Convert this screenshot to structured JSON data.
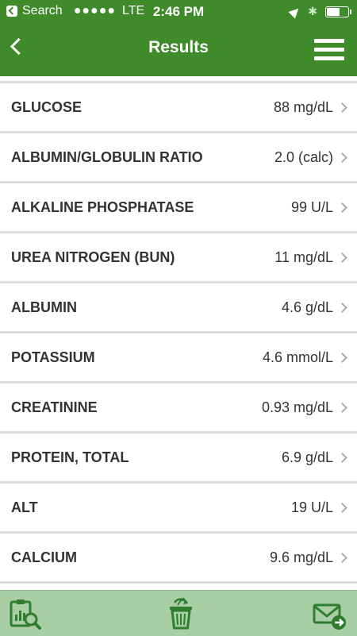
{
  "status_bar": {
    "carrier": "Search",
    "signal": "●●●●●",
    "network": "LTE",
    "time": "2:46 PM",
    "battery_level": 0.6
  },
  "nav": {
    "title": "Results"
  },
  "results": [
    {
      "name": "GLUCOSE",
      "value": "88 mg/dL"
    },
    {
      "name": "ALBUMIN/GLOBULIN RATIO",
      "value": "2.0 (calc)"
    },
    {
      "name": "ALKALINE PHOSPHATASE",
      "value": "99 U/L"
    },
    {
      "name": "UREA NITROGEN (BUN)",
      "value": "11 mg/dL"
    },
    {
      "name": "ALBUMIN",
      "value": "4.6 g/dL"
    },
    {
      "name": "POTASSIUM",
      "value": "4.6 mmol/L"
    },
    {
      "name": "CREATININE",
      "value": "0.93 mg/dL"
    },
    {
      "name": "PROTEIN, TOTAL",
      "value": "6.9 g/dL"
    },
    {
      "name": "ALT",
      "value": "19 U/L"
    },
    {
      "name": "CALCIUM",
      "value": "9.6 mg/dL"
    },
    {
      "name": "",
      "value": ""
    }
  ],
  "tabbar": {
    "icons": [
      "report-search-icon",
      "trash-recycle-icon",
      "mail-forward-icon"
    ]
  },
  "colors": {
    "header_green": "#3f8a2b",
    "tabbar_green": "#a9cda4",
    "icon_green": "#2f7d2f"
  }
}
